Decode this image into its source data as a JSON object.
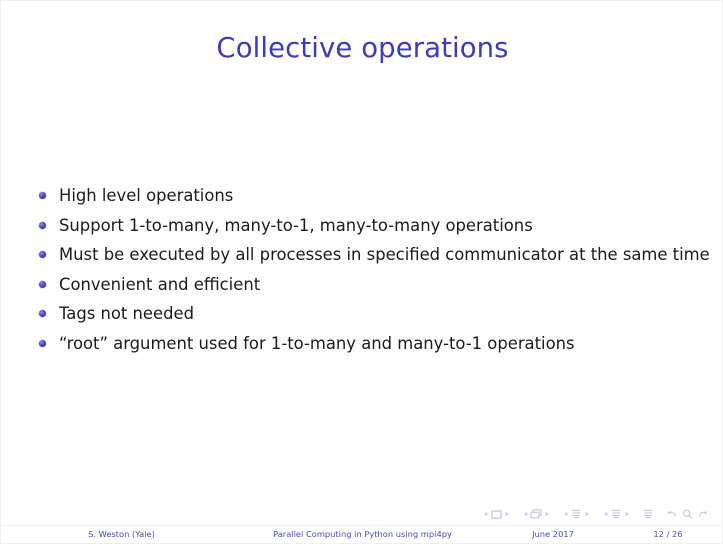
{
  "slide": {
    "title": "Collective operations",
    "title_color": "#3c3cba",
    "body_color": "#1a1a1a",
    "background": "#ffffff"
  },
  "bullets": [
    {
      "text": "High level operations"
    },
    {
      "text": "Support 1-to-many, many-to-1, many-to-many operations"
    },
    {
      "text": "Must be executed by all processes in specified communicator at the same time"
    },
    {
      "text": "Convenient and efficient"
    },
    {
      "text": "Tags not needed"
    },
    {
      "text": "“root” argument used for 1-to-many and many-to-1 operations"
    }
  ],
  "navigation": {
    "color": "#c9c9e8",
    "left_arrow": "◂",
    "right_arrow": "▸",
    "items": [
      {
        "name": "slide",
        "label": "slide-navigation-symbol"
      },
      {
        "name": "frame",
        "label": "frame-navigation-symbol"
      },
      {
        "name": "subsection",
        "label": "subsection-navigation-symbol"
      },
      {
        "name": "section",
        "label": "section-navigation-symbol"
      },
      {
        "name": "presentation",
        "label": "presentation-navigation-symbol"
      }
    ],
    "extra": [
      {
        "name": "back",
        "label": "back-navigation-symbol"
      },
      {
        "name": "find",
        "label": "find-navigation-symbol"
      },
      {
        "name": "forward",
        "label": "forward-navigation-symbol"
      }
    ]
  },
  "footer": {
    "author": "S. Weston  (Yale)",
    "title": "Parallel Computing in Python using mpi4py",
    "date": "June 2017",
    "page": "12 / 26",
    "color": "#4a4aae"
  }
}
